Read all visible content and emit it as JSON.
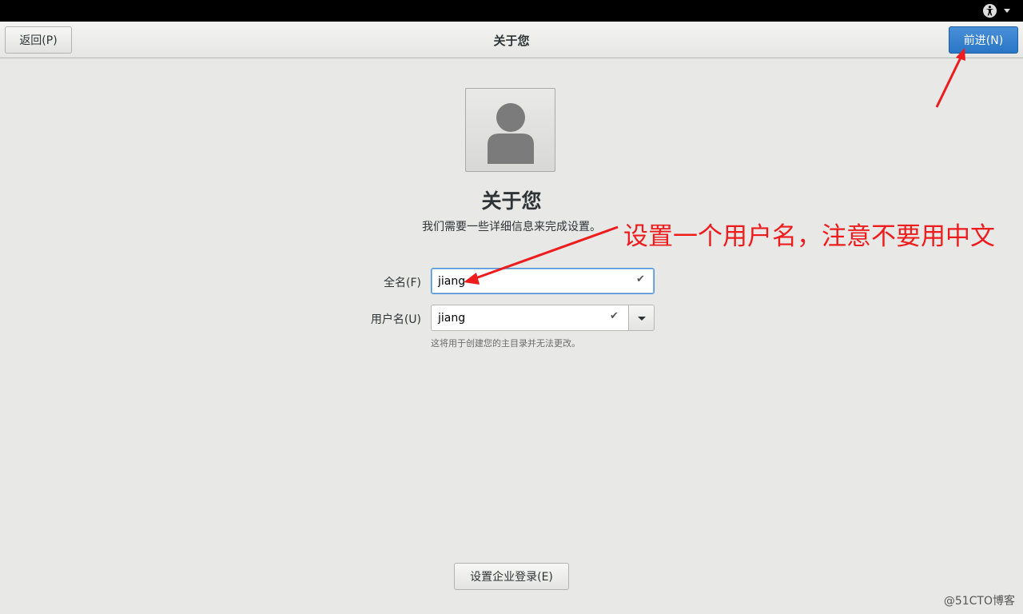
{
  "topbar": {
    "accessibility_icon": "accessibility-icon",
    "menu_icon": "chevron-down-icon"
  },
  "header": {
    "back_label": "返回(P)",
    "title": "关于您",
    "next_label": "前进(N)",
    "next_color": "#3584d8"
  },
  "main": {
    "avatar_icon": "user-avatar-icon",
    "heading": "关于您",
    "subtitle": "我们需要一些详细信息来完成设置。",
    "full_name": {
      "label": "全名(F)",
      "value": "jiang",
      "status_icon": "check-icon"
    },
    "username": {
      "label": "用户名(U)",
      "value": "jiang",
      "status_icon": "check-icon",
      "dropdown_icon": "chevron-down-icon"
    },
    "hint": "这将用于创建您的主目录并无法更改。",
    "enterprise_label": "设置企业登录(E)"
  },
  "annotation": {
    "text": "设置一个用户名，注意不要用中文",
    "color": "#ee1c1c"
  },
  "watermark": "@51CTO博客"
}
